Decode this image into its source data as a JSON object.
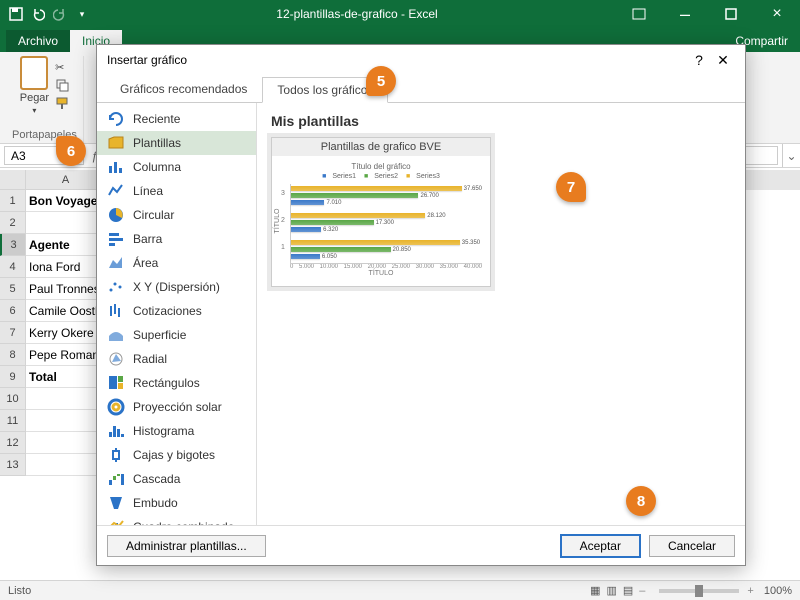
{
  "app": {
    "title": "12-plantillas-de-grafico - Excel",
    "status_ready": "Listo",
    "zoom": "100%"
  },
  "ribbon": {
    "file": "Archivo",
    "home": "Inicio",
    "share": "Compartir",
    "paste": "Pegar",
    "clipboard_group": "Portapapeles"
  },
  "namebox": "A3",
  "grid": {
    "columns": [
      "A"
    ],
    "rows": [
      {
        "n": "1",
        "val": "Bon Voyage",
        "bold": true
      },
      {
        "n": "2",
        "val": ""
      },
      {
        "n": "3",
        "val": "Agente",
        "bold": true,
        "hl": true
      },
      {
        "n": "4",
        "val": "Iona Ford"
      },
      {
        "n": "5",
        "val": "Paul Tronnes"
      },
      {
        "n": "6",
        "val": "Camile Oosthuizen"
      },
      {
        "n": "7",
        "val": "Kerry Okere"
      },
      {
        "n": "8",
        "val": "Pepe Roman"
      },
      {
        "n": "9",
        "val": "Total",
        "bold": true
      },
      {
        "n": "10",
        "val": ""
      },
      {
        "n": "11",
        "val": ""
      },
      {
        "n": "12",
        "val": ""
      },
      {
        "n": "13",
        "val": ""
      }
    ]
  },
  "dialog": {
    "title": "Insertar gráfico",
    "tab_recommended": "Gráficos recomendados",
    "tab_all": "Todos los gráficos",
    "chart_types": [
      {
        "key": "reciente",
        "label": "Reciente"
      },
      {
        "key": "plantillas",
        "label": "Plantillas",
        "selected": true
      },
      {
        "key": "columna",
        "label": "Columna"
      },
      {
        "key": "linea",
        "label": "Línea"
      },
      {
        "key": "circular",
        "label": "Circular"
      },
      {
        "key": "barra",
        "label": "Barra"
      },
      {
        "key": "area",
        "label": "Área"
      },
      {
        "key": "xy",
        "label": "X Y (Dispersión)"
      },
      {
        "key": "cotizaciones",
        "label": "Cotizaciones"
      },
      {
        "key": "superficie",
        "label": "Superficie"
      },
      {
        "key": "radial",
        "label": "Radial"
      },
      {
        "key": "rectangulos",
        "label": "Rectángulos"
      },
      {
        "key": "solar",
        "label": "Proyección solar"
      },
      {
        "key": "histograma",
        "label": "Histograma"
      },
      {
        "key": "cajas",
        "label": "Cajas y bigotes"
      },
      {
        "key": "cascada",
        "label": "Cascada"
      },
      {
        "key": "embudo",
        "label": "Embudo"
      },
      {
        "key": "combo",
        "label": "Cuadro combinado"
      }
    ],
    "preview_heading": "Mis plantillas",
    "template_name": "Plantillas de grafico BVE",
    "manage": "Administrar plantillas...",
    "ok": "Aceptar",
    "cancel": "Cancelar"
  },
  "chart_data": {
    "type": "bar",
    "title": "Título del gráfico",
    "xlabel": "TÍTULO",
    "ylabel": "TÍTULO",
    "xlim": [
      0,
      40000
    ],
    "xticks": [
      0,
      5000,
      10000,
      15000,
      20000,
      25000,
      30000,
      35000,
      40000
    ],
    "categories": [
      "1",
      "2",
      "3"
    ],
    "series": [
      {
        "name": "Series1",
        "color": "#3a79c9",
        "values": [
          6050,
          6320,
          7010
        ]
      },
      {
        "name": "Series2",
        "color": "#5aa746",
        "values": [
          20850,
          17300,
          26700
        ]
      },
      {
        "name": "Series3",
        "color": "#e8b42b",
        "values": [
          35350,
          28120,
          37650
        ]
      }
    ],
    "legend": [
      "Series1",
      "Series2",
      "Series3"
    ]
  },
  "callouts": {
    "c5": "5",
    "c6": "6",
    "c7": "7",
    "c8": "8"
  }
}
